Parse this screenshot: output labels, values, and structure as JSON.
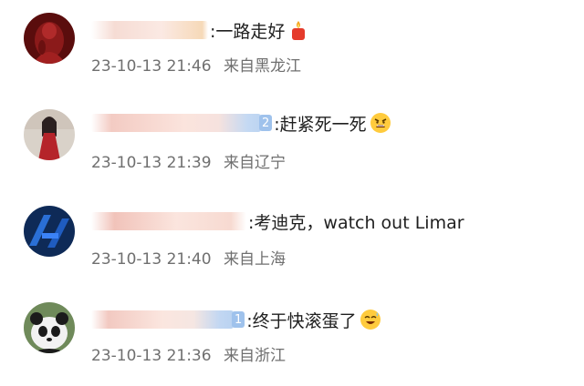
{
  "comments": [
    {
      "text": ":一路走好",
      "emoji": "candle-icon",
      "time": "23-10-13 21:46",
      "location": "来自黑龙江",
      "name_blur_colors": [
        "#f4cfc6",
        "#fbe6df",
        "#f5d8b8"
      ]
    },
    {
      "text": ":赶紧死一死",
      "emoji": "angry-face-icon",
      "time": "23-10-13 21:39",
      "location": "来自辽宁",
      "level": "2",
      "name_blur_colors": [
        "#f2c4bc",
        "#fbe3dc",
        "#bcd4f2"
      ]
    },
    {
      "text": ":考迪克，watch out Limar",
      "time": "23-10-13 21:40",
      "location": "来自上海",
      "name_blur_colors": [
        "#f1c0b7",
        "#fbe4dd",
        "#f6d6cc"
      ]
    },
    {
      "text": ":终于快滚蛋了",
      "emoji": "grinning-sweat-face-icon",
      "time": "23-10-13 21:36",
      "location": "来自浙江",
      "level": "1",
      "name_blur_colors": [
        "#f2c7bf",
        "#fbe6df",
        "#b9d2f1"
      ]
    }
  ]
}
